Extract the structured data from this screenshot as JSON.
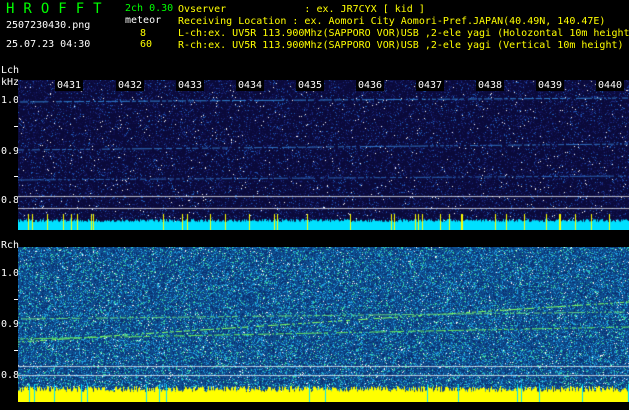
{
  "header": {
    "logo": "HROFFT",
    "channel_mode": "2ch 0.30",
    "filename": "2507230430.png",
    "meteor_label": "meteor",
    "count_lch": "8",
    "count_rch": "60",
    "datetime": "25.07.23 04:30",
    "observer_line": "Ovserver             : ex. JR7CYX [ kid ]",
    "location_line": "Receiving Location : ex. Aomori City Aomori-Pref.JAPAN(40.49N, 140.47E)",
    "lch_line": "L-ch:ex. UV5R 113.900Mhz(SAPPORO VOR)USB ,2-ele yagi (Holozontal 10m height)",
    "rch_line": "R-ch:ex. UV5R 113.900Mhz(SAPPORO VOR)USB ,2-ele yagi (Vertical 10m height)"
  },
  "lch": {
    "label": "Lch",
    "unit": "kHz",
    "time_ticks": [
      "0431",
      "0432",
      "0433",
      "0434",
      "0435",
      "0436",
      "0437",
      "0438",
      "0439",
      "0440"
    ],
    "freq_labels": [
      "1.0",
      "0.9",
      "0.8"
    ]
  },
  "rch": {
    "label": "Rch",
    "freq_labels": [
      "1.0",
      "0.9",
      "0.8"
    ]
  },
  "colors": {
    "label_green": "#00ff00",
    "text_white": "#ffffff",
    "meteor_count_yellow": "#ffff00",
    "lch_background": "#0a0a3a",
    "rch_background": "#1060a0",
    "lch_baseline": "#00e0ff",
    "rch_baseline": "#ffff00"
  }
}
